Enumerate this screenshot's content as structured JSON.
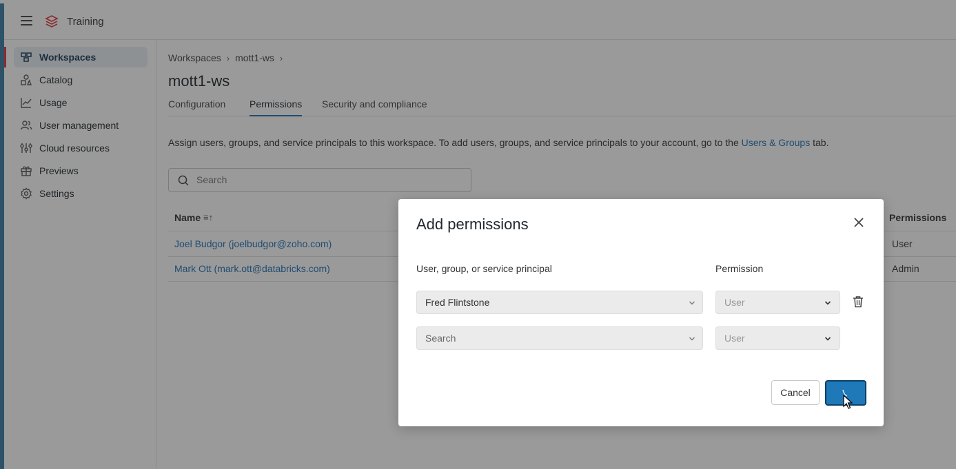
{
  "header": {
    "app_name": "Training",
    "menu_icon": "hamburger-menu-icon",
    "logo_icon": "databricks-logo-icon"
  },
  "sidebar": {
    "items": [
      {
        "label": "Workspaces",
        "icon": "workspaces-icon",
        "active": true
      },
      {
        "label": "Catalog",
        "icon": "catalog-icon",
        "active": false
      },
      {
        "label": "Usage",
        "icon": "usage-chart-icon",
        "active": false
      },
      {
        "label": "User management",
        "icon": "users-icon",
        "active": false
      },
      {
        "label": "Cloud resources",
        "icon": "cloud-resources-icon",
        "active": false
      },
      {
        "label": "Previews",
        "icon": "gift-icon",
        "active": false
      },
      {
        "label": "Settings",
        "icon": "gear-icon",
        "active": false
      }
    ]
  },
  "breadcrumb": {
    "items": [
      "Workspaces",
      "mott1-ws"
    ],
    "separator": "›"
  },
  "page": {
    "title": "mott1-ws",
    "tabs": [
      {
        "label": "Configuration",
        "active": false
      },
      {
        "label": "Permissions",
        "active": true
      },
      {
        "label": "Security and compliance",
        "active": false
      }
    ],
    "intro_prefix": "Assign users, groups, and service principals to this workspace. To add users, groups, and service principals to your account, go to the ",
    "intro_link": "Users & Groups",
    "intro_suffix": " tab.",
    "search_placeholder": "Search"
  },
  "table": {
    "columns": {
      "name": "Name",
      "sort_glyph": "≡↑",
      "permissions": "Permissions"
    },
    "rows": [
      {
        "name": "Joel Budgor (joelbudgor@zoho.com)",
        "permission": "User"
      },
      {
        "name": "Mark Ott (mark.ott@databricks.com)",
        "permission": "Admin"
      }
    ]
  },
  "modal": {
    "title": "Add permissions",
    "col_principal": "User, group, or service principal",
    "col_permission": "Permission",
    "rows": [
      {
        "principal": "Fred Flintstone",
        "permission": "User"
      },
      {
        "principal": "Search",
        "permission": "User"
      }
    ],
    "cancel_label": "Cancel",
    "colors": {
      "primary": "#1f78b8",
      "primary_border": "#0d3f66"
    }
  },
  "colors": {
    "accent": "#2272b4",
    "active_marker": "#e0383e"
  }
}
